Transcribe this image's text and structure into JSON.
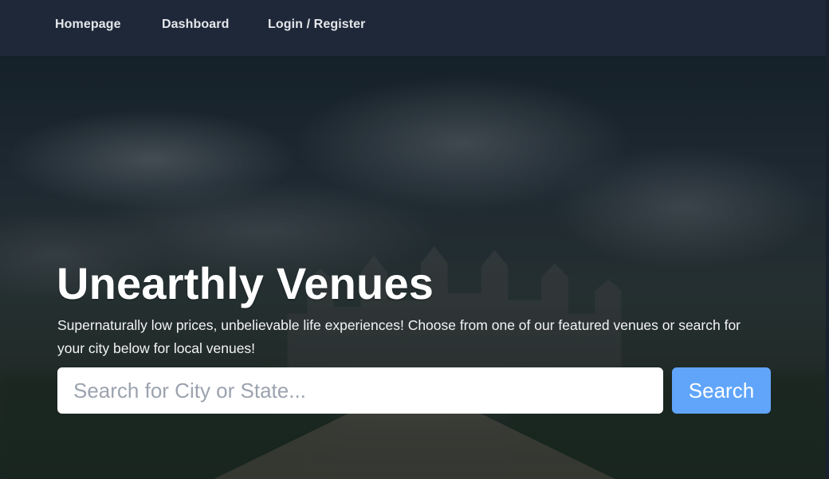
{
  "nav": {
    "items": [
      {
        "label": "Homepage"
      },
      {
        "label": "Dashboard"
      },
      {
        "label": "Login / Register"
      }
    ]
  },
  "hero": {
    "title": "Unearthly Venues",
    "description": "Supernaturally low prices, unbelievable life experiences! Choose from one of our featured venues or search for your city below for local venues!",
    "background_image": "blurred castle at end of long driveway under cloudy sky"
  },
  "search": {
    "value": "",
    "placeholder": "Search for City or State...",
    "button_label": "Search"
  },
  "colors": {
    "nav_background": "#1f2839",
    "nav_text": "#e5e7eb",
    "title_text": "#ffffff",
    "search_button": "#60a5fa",
    "input_background": "#ffffff",
    "placeholder_text": "#9ca3af"
  }
}
